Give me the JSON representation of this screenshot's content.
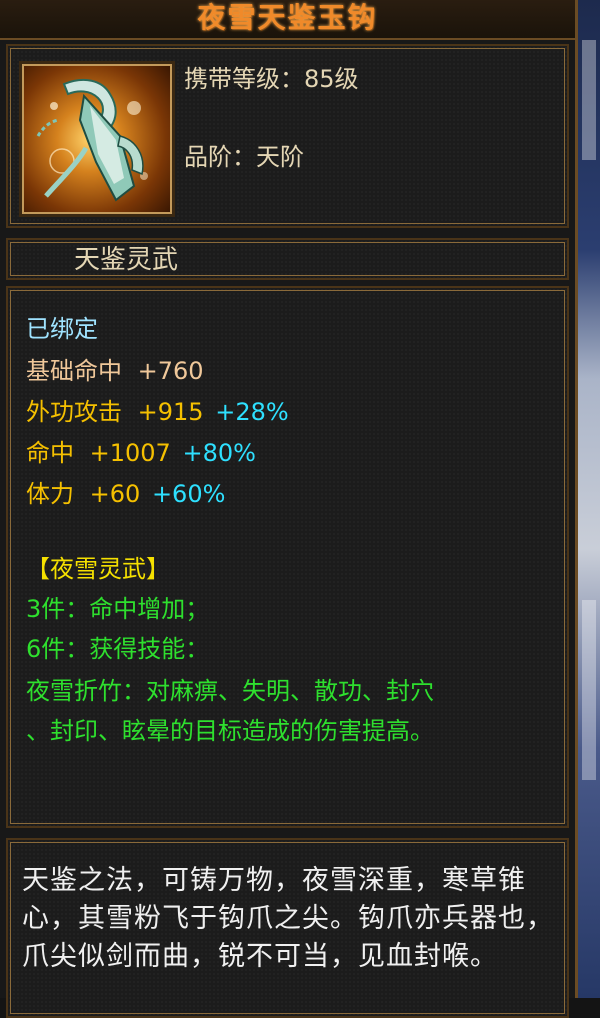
{
  "item": {
    "name": "夜雪天鉴玉钩",
    "level_label": "携带等级",
    "level_value": "85级",
    "grade_label": "品阶",
    "grade_value": "天阶",
    "category": "天鉴灵武"
  },
  "bound": "已绑定",
  "stats": [
    {
      "name": "基础命中",
      "value": "+760",
      "pct": ""
    },
    {
      "name": "外功攻击",
      "value": "+915",
      "pct": "+28%"
    },
    {
      "name": "命中",
      "value": "+1007",
      "pct": "+80%"
    },
    {
      "name": "体力",
      "value": "+60",
      "pct": "+60%"
    }
  ],
  "set": {
    "title": "【夜雪灵武】",
    "bonus_3": "3件：命中增加；",
    "bonus_6": "6件：获得技能：",
    "skill_line1": "夜雪折竹：对麻痹、失明、散功、封穴",
    "skill_line2": "、封印、眩晕的目标造成的伤害提高。"
  },
  "lore": "天鉴之法，可铸万物，夜雪深重，寒草锥心，其雪粉飞于钩爪之尖。钩爪亦兵器也，爪尖似剑而曲，锐不可当，见血封喉。",
  "colors": {
    "title": "#f08a2a",
    "bound": "#9fe3ff",
    "base_stat": "#f0c89a",
    "stat": "#f5c000",
    "percent": "#2ee0ff",
    "set_title": "#f5e000",
    "set_text": "#2ee02e",
    "frame": "#8a6a3a"
  },
  "icon": "jade-hook-weapon-icon"
}
